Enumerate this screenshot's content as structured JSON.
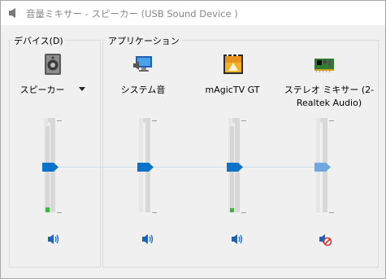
{
  "window": {
    "title": "音量ミキサー - スピーカー (USB Sound Device        )"
  },
  "devices_group": {
    "label": "デバイス(D)"
  },
  "apps_group": {
    "label": "アプリケーション"
  },
  "channels": [
    {
      "label": "スピーカー",
      "icon": "speaker-icon",
      "muted": false,
      "volume": 0.5,
      "peak": 0.06
    },
    {
      "label": "システム音",
      "icon": "system-sounds-icon",
      "muted": false,
      "volume": 0.5,
      "peak": 0.0
    },
    {
      "label": "mAgicTV GT",
      "icon": "magictv-icon",
      "muted": false,
      "volume": 0.5,
      "peak": 0.05
    },
    {
      "label": "ステレオ ミキサー (2- Realtek Audio)",
      "icon": "sound-card-icon",
      "muted": true,
      "volume": 0.5,
      "peak": 0.0
    }
  ],
  "colors": {
    "thumb_active": "#0a72c8",
    "thumb_muted": "#6fa9e0",
    "meter_peak": "#3bb63b"
  }
}
